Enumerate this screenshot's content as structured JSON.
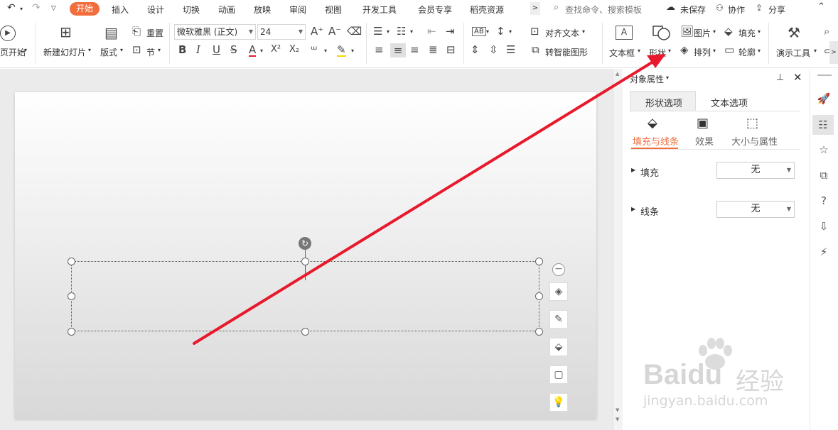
{
  "topbar": {
    "undo_icon": "undo-icon",
    "redo_icon": "redo-icon",
    "tabs": [
      "开始",
      "插入",
      "设计",
      "切换",
      "动画",
      "放映",
      "审阅",
      "视图",
      "开发工具",
      "会员专享",
      "稻壳资源"
    ],
    "search_placeholder": "查找命令、搜索模板",
    "unsaved": "未保存",
    "collab": "协作",
    "share": "分享"
  },
  "ribbon": {
    "from_start": "页开始",
    "new_slide": "新建幻灯片",
    "layout": "版式",
    "reset": "重置",
    "section": "节",
    "font_name": "微软雅黑 (正文)",
    "font_size": "24",
    "align_text": "对齐文本",
    "smartart": "转智能图形",
    "text_box": "文本框",
    "shape": "形状",
    "picture": "图片",
    "fill": "填充",
    "arrange": "排列",
    "outline": "轮廓",
    "presentation_tools": "演示工具",
    "bold": "B",
    "italic": "I",
    "underline": "U",
    "strike": "S",
    "font_color": "A",
    "superscript": "X²",
    "subscript": "X₂",
    "text_direction": "AB"
  },
  "panel": {
    "title": "对象属性",
    "tab_shape": "形状选项",
    "tab_text": "文本选项",
    "sub_fill_line": "填充与线条",
    "sub_effect": "效果",
    "sub_size": "大小与属性",
    "fill_label": "填充",
    "fill_value": "无",
    "line_label": "线条",
    "line_value": "无"
  },
  "watermark": {
    "logo_text": "Baidu",
    "logo_cn": "经验",
    "url": "jingyan.baidu.com"
  },
  "colors": {
    "accent": "#f26d3c",
    "annotation_arrow": "#e8192c"
  }
}
